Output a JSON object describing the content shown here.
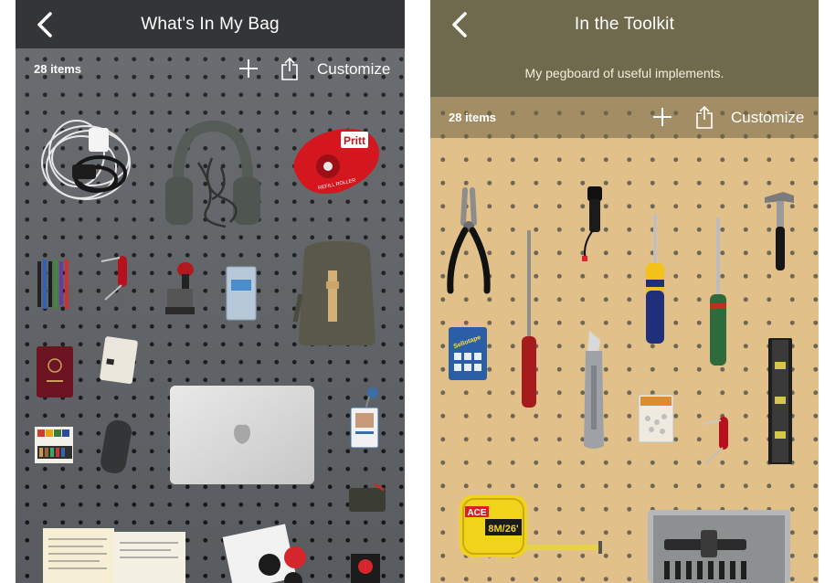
{
  "left_screen": {
    "title": "What's In My Bag",
    "item_count": "28 items",
    "customize_label": "Customize",
    "items": {
      "pritt_brand": "Pritt",
      "pritt_sub": "REFILL ROLLER"
    }
  },
  "right_screen": {
    "title": "In the Toolkit",
    "subtitle": "My pegboard of useful implements.",
    "item_count": "28 items",
    "customize_label": "Customize",
    "items": {
      "sellotape": "Sellotape",
      "ace_brand": "ACE",
      "tape_size": "8M/26'"
    }
  },
  "icons": {
    "back": "chevron-left-icon",
    "add": "plus-icon",
    "share": "share-icon"
  },
  "colors": {
    "left_nav": "#333537",
    "left_board": "#5d6064",
    "right_nav": "#6f6a4d",
    "right_board": "#e2c08a"
  }
}
